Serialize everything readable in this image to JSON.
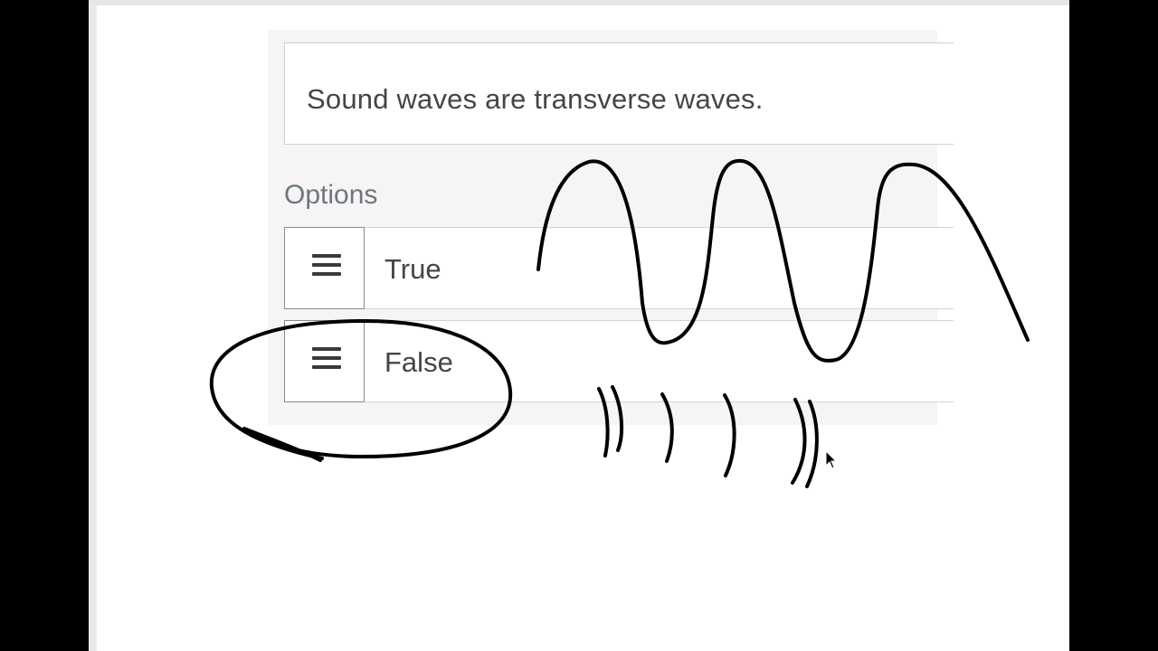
{
  "question": {
    "statement": "Sound waves are transverse waves."
  },
  "options": {
    "heading": "Options",
    "items": [
      {
        "label": "True",
        "handle_icon": "hamburger-icon"
      },
      {
        "label": "False",
        "handle_icon": "hamburger-icon"
      }
    ]
  },
  "annotations": {
    "ink_color": "#000000",
    "marks": [
      "circle-around-false",
      "transverse-wave-sketch",
      "longitudinal-wave-sketch"
    ]
  },
  "colors": {
    "panel_background": "#f6f4f4",
    "text": "#454545",
    "heading_text": "#6c7780"
  }
}
